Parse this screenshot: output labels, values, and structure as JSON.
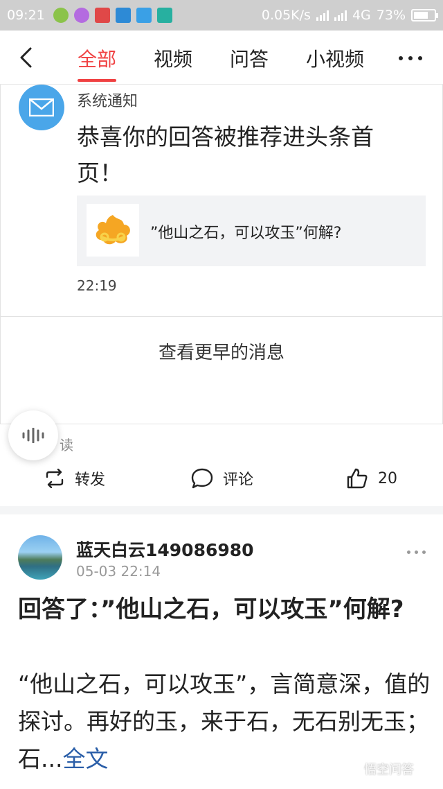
{
  "status_bar": {
    "time": "09:21",
    "network_speed": "0.05K/s",
    "network_type": "4G",
    "battery": "73%",
    "battery_fraction": 0.73
  },
  "nav": {
    "tabs": [
      {
        "label": "全部",
        "active": true
      },
      {
        "label": "视频",
        "active": false
      },
      {
        "label": "问答",
        "active": false
      },
      {
        "label": "小视频",
        "active": false
      }
    ]
  },
  "notification": {
    "sender": "系统通知",
    "title": "恭喜你的回答被推荐进头条首页！",
    "quote": "”他山之石，可以攻玉”何解?",
    "time": "22:19",
    "earlier_label": "查看更早的消息"
  },
  "read": {
    "label": "读"
  },
  "actions": {
    "repost": "转发",
    "comment": "评论",
    "like_count": "20"
  },
  "post": {
    "username": "蓝天白云149086980",
    "time": "05-03 22:14",
    "title": "回答了：”他山之石，可以攻玉”何解?",
    "excerpt": "“他山之石，可以攻玉”，言简意深，值的探讨。再好的玉，来于石，无石别无玉；石...",
    "fulltext_label": "全文"
  },
  "watermark": "悟空问答",
  "colors": {
    "accent_red": "#f04142",
    "mail_blue": "#4aa6e9",
    "link_blue": "#2a5ea8"
  }
}
